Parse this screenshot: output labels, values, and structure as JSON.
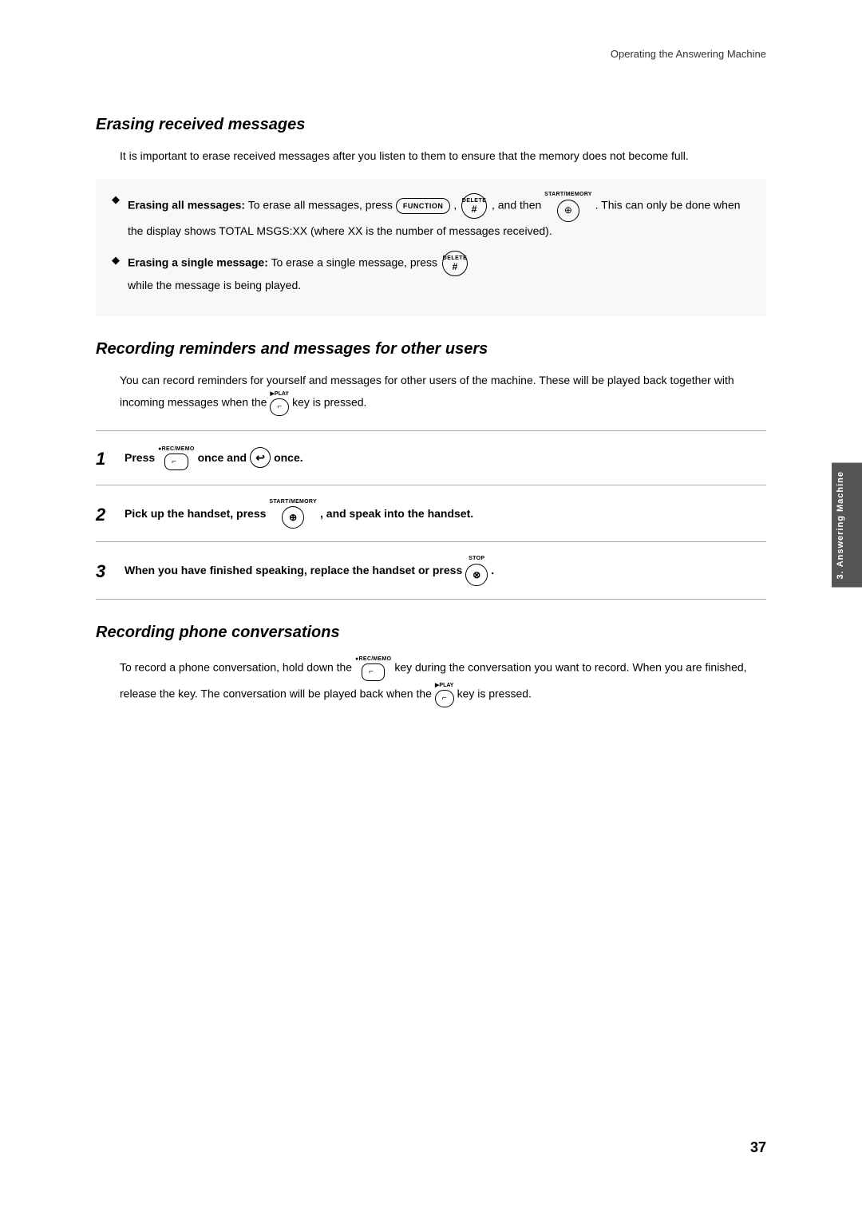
{
  "page": {
    "header": "Operating the Answering Machine",
    "page_number": "37",
    "side_tab": "Answering Machine",
    "side_tab_number": "3."
  },
  "section1": {
    "title": "Erasing received messages",
    "intro": "It is important to erase received messages after you listen to them to ensure that the memory does not become full.",
    "bullets": [
      {
        "label": "Erasing all messages:",
        "text_before": "To erase all messages, press",
        "key1": "FUNCTION",
        "separator": ",",
        "key2": "#",
        "key2_label": "DELETE",
        "text_after": ", and then",
        "key3_label": "START/MEMORY",
        "text_after2": ". This can only be done when the display shows TOTAL MSGS:XX (where XX is the number of messages received)."
      },
      {
        "label": "Erasing a single message:",
        "text_before": "To erase a single message, press",
        "key_label": "DELETE",
        "text_after": "while the message is being played."
      }
    ]
  },
  "section2": {
    "title": "Recording reminders and messages for other users",
    "intro1": "You can record reminders for yourself and messages for other users of the machine. These will be played back together with incoming messages when the",
    "intro2": "key is pressed.",
    "steps": [
      {
        "number": "1",
        "text_prefix": "Press",
        "key_rec_label": "●REC/\nMEMO",
        "text_middle": "once and",
        "key_hook": "↩",
        "text_suffix": "once."
      },
      {
        "number": "2",
        "text_prefix": "Pick up the handset, press",
        "key_label": "START/MEMORY",
        "text_suffix": ", and speak into the handset."
      },
      {
        "number": "3",
        "text_prefix": "When you have finished speaking, replace the handset or press",
        "key_label": "STOP",
        "text_suffix": "."
      }
    ]
  },
  "section3": {
    "title": "Recording phone conversations",
    "intro1": "To record a phone conversation, hold down the",
    "key_label": "●REC/\nMEMO",
    "intro2": "key during the conversation you want to record. When you are finished, release the key. The conversation will be played back when the",
    "play_label": "▶PLAY",
    "intro3": "key is pressed."
  }
}
